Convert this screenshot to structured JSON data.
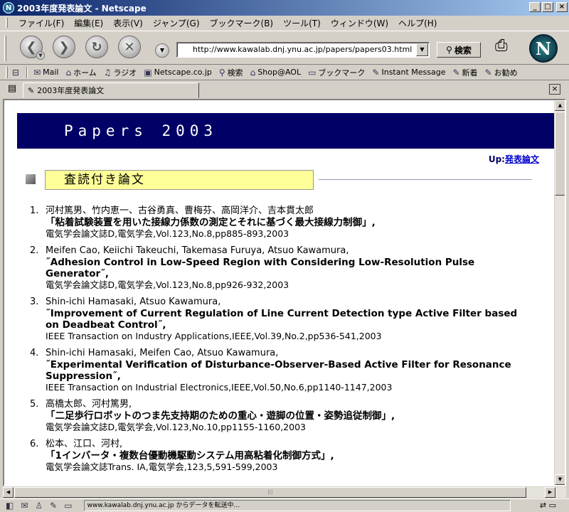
{
  "window": {
    "title": "2003年度発表論文 - Netscape"
  },
  "menu": [
    "ファイル(F)",
    "編集(E)",
    "表示(V)",
    "ジャンプ(G)",
    "ブックマーク(B)",
    "ツール(T)",
    "ウィンドウ(W)",
    "ヘルプ(H)"
  ],
  "nav": {
    "url": "http://www.kawalab.dnj.ynu.ac.jp/papers/papers03.html",
    "search_label": "検索",
    "logo_letter": "N"
  },
  "personal_toolbar": [
    {
      "icon": "mail-icon",
      "glyph": "✉",
      "label": "Mail"
    },
    {
      "icon": "home-icon",
      "glyph": "⌂",
      "label": "ホーム"
    },
    {
      "icon": "radio-icon",
      "glyph": "♫",
      "label": "ラジオ"
    },
    {
      "icon": "netscape-icon",
      "glyph": "▣",
      "label": "Netscape.co.jp"
    },
    {
      "icon": "search-icon",
      "glyph": "⚲",
      "label": "検索"
    },
    {
      "icon": "shop-icon",
      "glyph": "⌂",
      "label": "Shop@AOL"
    },
    {
      "icon": "bookmark-folder-icon",
      "glyph": "▭",
      "label": "ブックマーク"
    },
    {
      "icon": "link-icon",
      "glyph": "✎",
      "label": "Instant Message"
    },
    {
      "icon": "link-icon",
      "glyph": "✎",
      "label": "新着"
    },
    {
      "icon": "link-icon",
      "glyph": "✎",
      "label": "お勧め"
    }
  ],
  "tab": {
    "label": "2003年度発表論文"
  },
  "page": {
    "banner": "Papers 2003",
    "up_prefix": "Up:",
    "up_link": "発表論文",
    "section_title": "査読付き論文",
    "papers": [
      {
        "num": "1.",
        "authors": "河村篤男、竹内恵一、古谷勇真、曹梅芬、高岡洋介、吉本貫太郎",
        "title": "「粘着試験装置を用いた接線力係数の測定とそれに基づく最大接線力制御」,",
        "venue": "電気学会論文誌D,電気学会,Vol.123,No.8,pp885-893,2003"
      },
      {
        "num": "2.",
        "authors": "Meifen Cao, Keiichi Takeuchi, Takemasa Furuya, Atsuo Kawamura,",
        "title": "˝Adhesion Control in Low-Speed Region with Considering Low-Resolution Pulse Generator˝,",
        "venue": "電気学会論文誌D,電気学会,Vol.123,No.8,pp926-932,2003"
      },
      {
        "num": "3.",
        "authors": "Shin-ichi Hamasaki, Atsuo Kawamura,",
        "title": "˝Improvement of Current Regulation of Line Current Detection type Active Filter based on Deadbeat Control˝,",
        "venue": "IEEE Transaction on Industry Applications,IEEE,Vol.39,No.2,pp536-541,2003"
      },
      {
        "num": "4.",
        "authors": "Shin-ichi Hamasaki, Meifen Cao, Atsuo Kawamura,",
        "title": "˝Experimental Verification of Disturbance-Observer-Based Active Filter for Resonance Suppression˝,",
        "venue": "IEEE Transaction on Industrial Electronics,IEEE,Vol.50,No.6,pp1140-1147,2003"
      },
      {
        "num": "5.",
        "authors": "高橋太郎、河村篤男,",
        "title": "「二足歩行ロボットのつま先支持期のための重心・遊脚の位置・姿勢追従制御」,",
        "venue": "電気学会論文誌D,電気学会,Vol.123,No.10,pp1155-1160,2003"
      },
      {
        "num": "6.",
        "authors": "松本、江口、河村,",
        "title": "「1インバータ・複数台優動機駆動システム用高粘着化制御方式」,",
        "venue": "電気学会論文誌Trans. IA,電気学会,123,5,591-599,2003"
      }
    ]
  },
  "status": {
    "text": "www.kawalab.dnj.ynu.ac.jp からデータを転送中..."
  }
}
